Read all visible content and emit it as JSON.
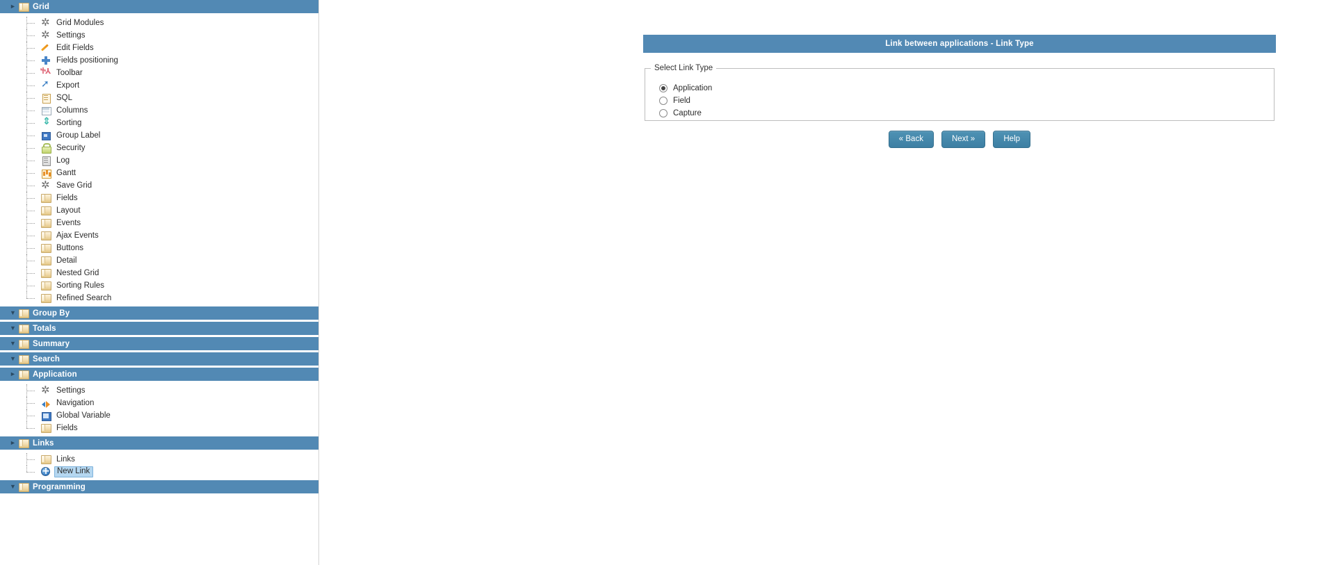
{
  "sidebar": {
    "groups": [
      {
        "label": "Grid",
        "state": "expanded",
        "arrow": "►",
        "items": [
          {
            "label": "Grid Modules",
            "icon": "gear-icon",
            "iconClass": "ic-gear"
          },
          {
            "label": "Settings",
            "icon": "gear-icon",
            "iconClass": "ic-gear"
          },
          {
            "label": "Edit Fields",
            "icon": "pencil-icon",
            "iconClass": "ic-pencil"
          },
          {
            "label": "Fields positioning",
            "icon": "plus-icon",
            "iconClass": "ic-plus"
          },
          {
            "label": "Toolbar",
            "icon": "toolbar-icon",
            "iconClass": "ic-toolbar"
          },
          {
            "label": "Export",
            "icon": "export-arrow-icon",
            "iconClass": "ic-export"
          },
          {
            "label": "SQL",
            "icon": "sql-icon",
            "iconClass": "ic-sql"
          },
          {
            "label": "Columns",
            "icon": "columns-icon",
            "iconClass": "ic-columns"
          },
          {
            "label": "Sorting",
            "icon": "sorting-icon",
            "iconClass": "ic-sorting"
          },
          {
            "label": "Group Label",
            "icon": "group-label-icon",
            "iconClass": "ic-grouplabel"
          },
          {
            "label": "Security",
            "icon": "lock-icon",
            "iconClass": "ic-security"
          },
          {
            "label": "Log",
            "icon": "log-icon",
            "iconClass": "ic-log"
          },
          {
            "label": "Gantt",
            "icon": "gantt-chart-icon",
            "iconClass": "ic-gantt"
          },
          {
            "label": "Save Grid",
            "icon": "gear-icon",
            "iconClass": "ic-gear"
          },
          {
            "label": "Fields",
            "icon": "folder-icon",
            "iconClass": "ic-folder"
          },
          {
            "label": "Layout",
            "icon": "folder-icon",
            "iconClass": "ic-folder"
          },
          {
            "label": "Events",
            "icon": "folder-icon",
            "iconClass": "ic-folder"
          },
          {
            "label": "Ajax Events",
            "icon": "folder-icon",
            "iconClass": "ic-folder"
          },
          {
            "label": "Buttons",
            "icon": "folder-icon",
            "iconClass": "ic-folder"
          },
          {
            "label": "Detail",
            "icon": "folder-icon",
            "iconClass": "ic-folder"
          },
          {
            "label": "Nested Grid",
            "icon": "folder-icon",
            "iconClass": "ic-folder"
          },
          {
            "label": "Sorting Rules",
            "icon": "folder-icon",
            "iconClass": "ic-folder"
          },
          {
            "label": "Refined Search",
            "icon": "folder-icon",
            "iconClass": "ic-folder",
            "last": true
          }
        ]
      },
      {
        "label": "Group By",
        "state": "collapsed",
        "arrow": "▼",
        "items": []
      },
      {
        "label": "Totals",
        "state": "collapsed",
        "arrow": "▼",
        "items": []
      },
      {
        "label": "Summary",
        "state": "collapsed",
        "arrow": "▼",
        "items": []
      },
      {
        "label": "Search",
        "state": "collapsed",
        "arrow": "▼",
        "items": []
      },
      {
        "label": "Application",
        "state": "expanded",
        "arrow": "►",
        "items": [
          {
            "label": "Settings",
            "icon": "gear-icon",
            "iconClass": "ic-gear"
          },
          {
            "label": "Navigation",
            "icon": "navigation-icon",
            "iconClass": "ic-navigation"
          },
          {
            "label": "Global Variable",
            "icon": "global-variable-icon",
            "iconClass": "ic-globalvar"
          },
          {
            "label": "Fields",
            "icon": "folder-icon",
            "iconClass": "ic-folder",
            "last": true
          }
        ]
      },
      {
        "label": "Links",
        "state": "expanded",
        "arrow": "►",
        "items": [
          {
            "label": "Links",
            "icon": "folder-icon",
            "iconClass": "ic-folder"
          },
          {
            "label": "New Link",
            "icon": "new-link-icon",
            "iconClass": "ic-newlink",
            "selected": true,
            "last": true
          }
        ]
      },
      {
        "label": "Programming",
        "state": "collapsed",
        "arrow": "▼",
        "items": []
      }
    ]
  },
  "panel": {
    "title": "Link between applications - Link Type",
    "fieldset_legend": "Select Link Type",
    "options": [
      {
        "label": "Application",
        "selected": true
      },
      {
        "label": "Field",
        "selected": false
      },
      {
        "label": "Capture",
        "selected": false
      }
    ],
    "buttons": [
      {
        "label": "« Back",
        "name": "back-button"
      },
      {
        "label": "Next »",
        "name": "next-button"
      },
      {
        "label": "Help",
        "name": "help-button"
      }
    ]
  },
  "colors": {
    "header_blue": "#5289b4",
    "button_blue": "#3d7fa3",
    "selection_blue": "#b5d7f0"
  }
}
